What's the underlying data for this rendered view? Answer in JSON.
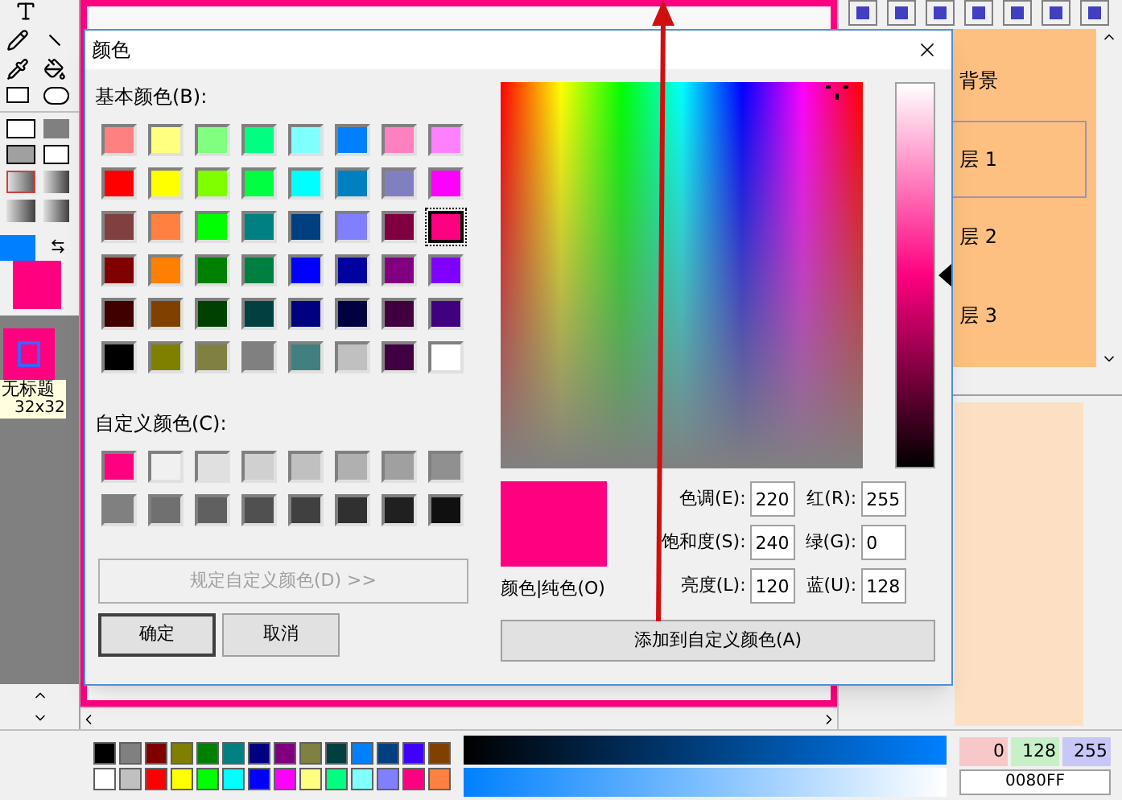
{
  "app": {
    "thumbnail": {
      "title": "无标题",
      "size": "32x32"
    },
    "layers": [
      {
        "name": "背景",
        "selected": false
      },
      {
        "name": "层 1",
        "selected": true
      },
      {
        "name": "层 2",
        "selected": false
      },
      {
        "name": "层 3",
        "selected": false
      }
    ],
    "palette": [
      {
        "color": "#000000"
      },
      {
        "color": "#808080"
      },
      {
        "color": "#800000"
      },
      {
        "color": "#808000"
      },
      {
        "color": "#008000"
      },
      {
        "color": "#008080"
      },
      {
        "color": "#000080"
      },
      {
        "color": "#800080"
      },
      {
        "color": "#808040"
      },
      {
        "color": "#004040"
      },
      {
        "color": "#0080ff"
      },
      {
        "color": "#004080"
      },
      {
        "color": "#4000ff"
      },
      {
        "color": "#804000"
      },
      {
        "color": "#ffffff"
      },
      {
        "color": "#c0c0c0"
      },
      {
        "color": "#ff0000"
      },
      {
        "color": "#ffff00"
      },
      {
        "color": "#00ff00"
      },
      {
        "color": "#00ffff"
      },
      {
        "color": "#0000ff"
      },
      {
        "color": "#ff00ff"
      },
      {
        "color": "#ffff80"
      },
      {
        "color": "#00ff80"
      },
      {
        "color": "#80ffff"
      },
      {
        "color": "#8080ff"
      },
      {
        "color": "#ff0080"
      },
      {
        "color": "#ff8040"
      }
    ],
    "color_values": [
      "0",
      "128",
      "255"
    ],
    "hex": "0080FF"
  },
  "dialog": {
    "title": "颜色",
    "basic_label": "基本颜色(B):",
    "basic_colors": [
      {
        "color": "#ff8080",
        "selected": false
      },
      {
        "color": "#ffff80",
        "selected": false
      },
      {
        "color": "#80ff80",
        "selected": false
      },
      {
        "color": "#00ff80",
        "selected": false
      },
      {
        "color": "#80ffff",
        "selected": false
      },
      {
        "color": "#0080ff",
        "selected": false
      },
      {
        "color": "#ff80c0",
        "selected": false
      },
      {
        "color": "#ff80ff",
        "selected": false
      },
      {
        "color": "#ff0000",
        "selected": false
      },
      {
        "color": "#ffff00",
        "selected": false
      },
      {
        "color": "#80ff00",
        "selected": false
      },
      {
        "color": "#00ff40",
        "selected": false
      },
      {
        "color": "#00ffff",
        "selected": false
      },
      {
        "color": "#0080c0",
        "selected": false
      },
      {
        "color": "#8080c0",
        "selected": false
      },
      {
        "color": "#ff00ff",
        "selected": false
      },
      {
        "color": "#804040",
        "selected": false
      },
      {
        "color": "#ff8040",
        "selected": false
      },
      {
        "color": "#00ff00",
        "selected": false
      },
      {
        "color": "#008080",
        "selected": false
      },
      {
        "color": "#004080",
        "selected": false
      },
      {
        "color": "#8080ff",
        "selected": false
      },
      {
        "color": "#800040",
        "selected": false
      },
      {
        "color": "#ff0080",
        "selected": true
      },
      {
        "color": "#800000",
        "selected": false
      },
      {
        "color": "#ff8000",
        "selected": false
      },
      {
        "color": "#008000",
        "selected": false
      },
      {
        "color": "#008040",
        "selected": false
      },
      {
        "color": "#0000ff",
        "selected": false
      },
      {
        "color": "#0000a0",
        "selected": false
      },
      {
        "color": "#800080",
        "selected": false
      },
      {
        "color": "#8000ff",
        "selected": false
      },
      {
        "color": "#400000",
        "selected": false
      },
      {
        "color": "#804000",
        "selected": false
      },
      {
        "color": "#004000",
        "selected": false
      },
      {
        "color": "#004040",
        "selected": false
      },
      {
        "color": "#000080",
        "selected": false
      },
      {
        "color": "#000040",
        "selected": false
      },
      {
        "color": "#400040",
        "selected": false
      },
      {
        "color": "#400080",
        "selected": false
      },
      {
        "color": "#000000",
        "selected": false
      },
      {
        "color": "#808000",
        "selected": false
      },
      {
        "color": "#808040",
        "selected": false
      },
      {
        "color": "#808080",
        "selected": false
      },
      {
        "color": "#408080",
        "selected": false
      },
      {
        "color": "#c0c0c0",
        "selected": false
      },
      {
        "color": "#400041",
        "selected": false
      },
      {
        "color": "#ffffff",
        "selected": false
      }
    ],
    "custom_label": "自定义颜色(C):",
    "custom_colors": [
      {
        "color": "#ff0080"
      },
      {
        "color": "#f0f0f0"
      },
      {
        "color": "#e0e0e0"
      },
      {
        "color": "#d0d0d0"
      },
      {
        "color": "#c0c0c0"
      },
      {
        "color": "#b0b0b0"
      },
      {
        "color": "#a0a0a0"
      },
      {
        "color": "#909090"
      },
      {
        "color": "#808080"
      },
      {
        "color": "#707070"
      },
      {
        "color": "#606060"
      },
      {
        "color": "#505050"
      },
      {
        "color": "#404040"
      },
      {
        "color": "#303030"
      },
      {
        "color": "#202020"
      },
      {
        "color": "#101010"
      }
    ],
    "define_button": {
      "label": "规定自定义颜色(D) >>",
      "disabled": true
    },
    "ok_button": "确定",
    "cancel_button": "取消",
    "luminance": {
      "level": 0.5
    },
    "preview_label": "颜色|纯色(O)",
    "hsl_fields": [
      {
        "label": "色调(E):",
        "value": "220"
      },
      {
        "label": "饱和度(S):",
        "value": "240"
      },
      {
        "label": "亮度(L):",
        "value": "120"
      }
    ],
    "rgb_fields": [
      {
        "label": "红(R):",
        "value": "255"
      },
      {
        "label": "绿(G):",
        "value": "0"
      },
      {
        "label": "蓝(U):",
        "value": "128"
      }
    ],
    "add_button": "添加到自定义颜色(A)"
  }
}
